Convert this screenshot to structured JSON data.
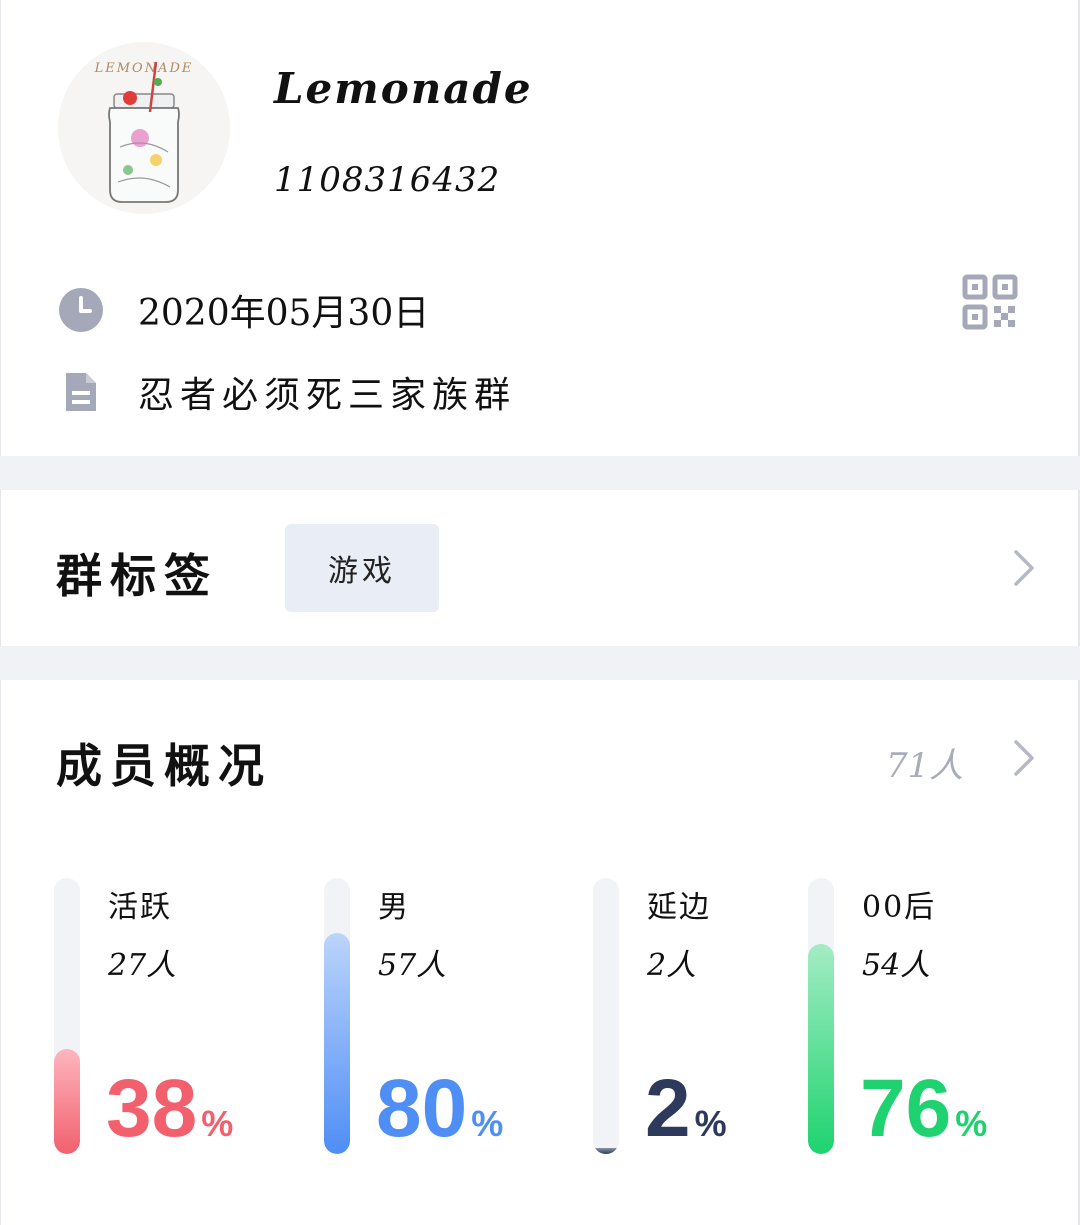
{
  "profile": {
    "name": "Lemonade",
    "id": "1108316432",
    "avatar_icon": "lemonade-jar-avatar",
    "avatar_caption": "LEMONADE"
  },
  "info": {
    "date": "2020年05月30日",
    "date_icon": "clock-icon",
    "description": "忍者必须死三家族群",
    "description_icon": "document-icon",
    "qr_icon": "qr-code-icon"
  },
  "tags": {
    "title": "群标签",
    "items": [
      "游戏"
    ]
  },
  "members": {
    "title": "成员概况",
    "count": "71人",
    "stats": [
      {
        "label": "活跃",
        "count": "27人",
        "percent": "38",
        "fraction": 0.38,
        "color": "#f2606e",
        "color_light": "#fdb6be"
      },
      {
        "label": "男",
        "count": "57人",
        "percent": "80",
        "fraction": 0.8,
        "color": "#4f8ef5",
        "color_light": "#bcd4fb"
      },
      {
        "label": "延边",
        "count": "2人",
        "percent": "2",
        "fraction": 0.02,
        "color": "#2e3a5c",
        "color_light": "#8a93a8"
      },
      {
        "label": "00后",
        "count": "54人",
        "percent": "76",
        "fraction": 0.76,
        "color": "#1ed36f",
        "color_light": "#a4ecc4"
      }
    ],
    "percent_sign": "%"
  },
  "colors": {
    "icon_gray": "#a4a8b8",
    "divider": "#f1f2f6",
    "chip_bg": "#e9edf5",
    "muted_text": "#a8adb9"
  }
}
